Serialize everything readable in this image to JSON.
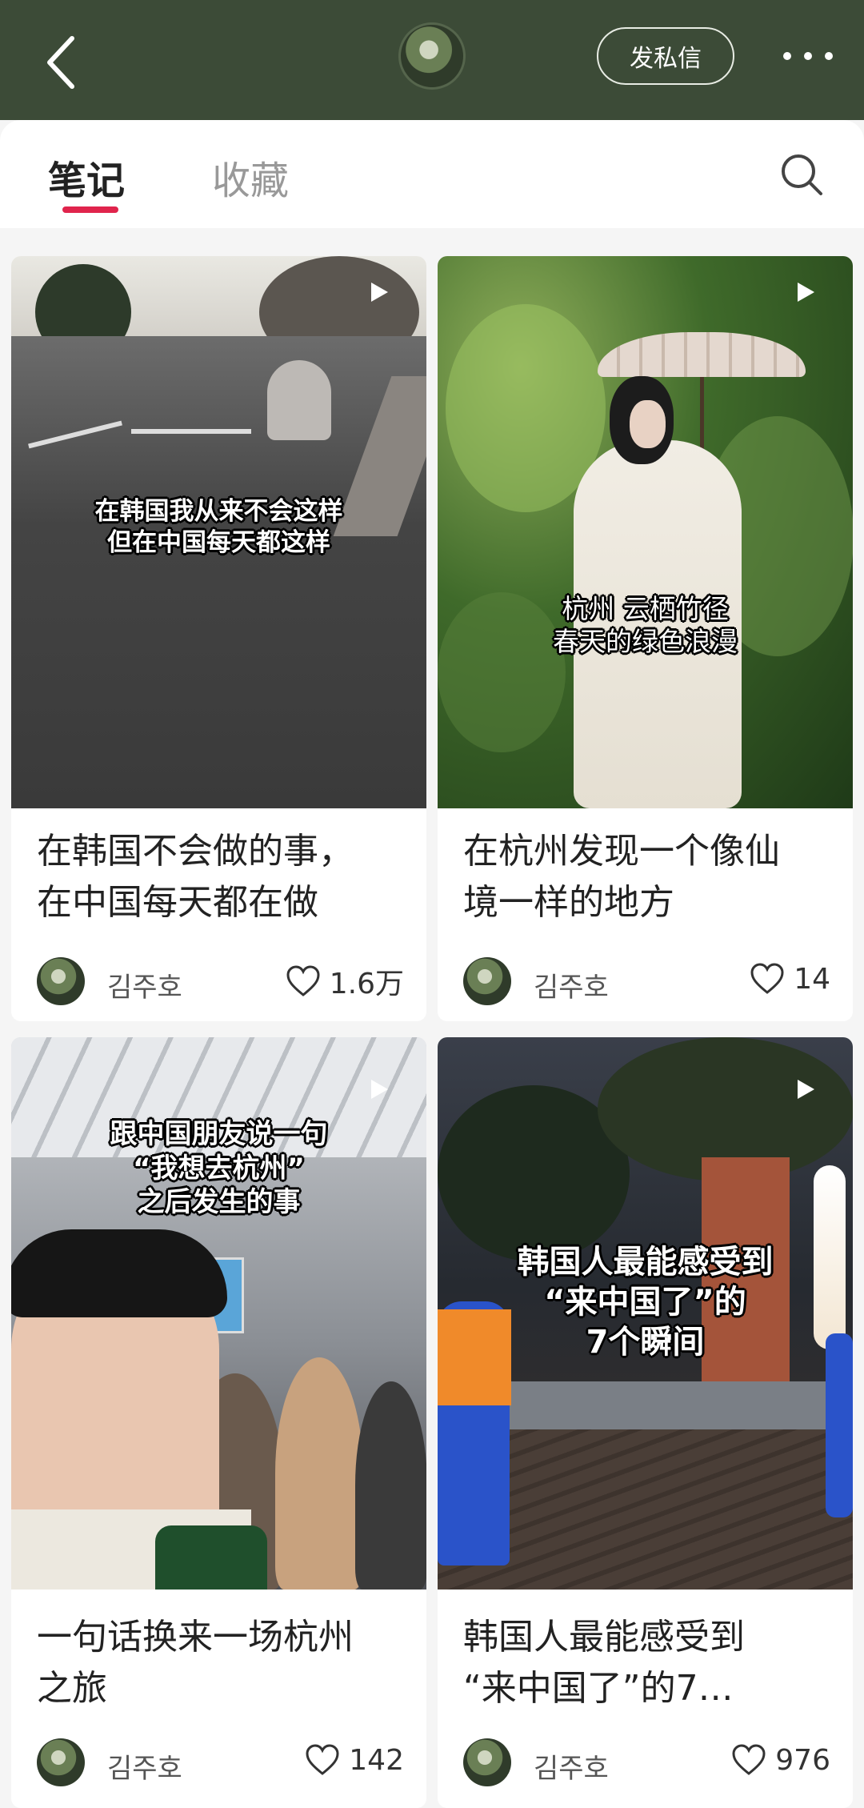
{
  "header": {
    "dm_label": "发私信"
  },
  "tabs": [
    {
      "label": "笔记",
      "active": true
    },
    {
      "label": "收藏",
      "active": false
    }
  ],
  "colors": {
    "header_bg": "#3c4b37",
    "accent": "#e0244c"
  },
  "cards": [
    {
      "overlay": [
        "在韩国我从来不会这样",
        "但在中国每天都这样"
      ],
      "title": [
        "在韩国不会做的事，",
        "在中国每天都在做"
      ],
      "author": "김주호",
      "likes": "1.6万"
    },
    {
      "overlay": [
        "杭州 云栖竹径",
        "春天的绿色浪漫"
      ],
      "title": [
        "在杭州发现一个像仙",
        "境一样的地方"
      ],
      "author": "김주호",
      "likes": "14"
    },
    {
      "overlay": [
        "跟中国朋友说一句",
        "“我想去杭州”",
        "之后发生的事"
      ],
      "title": [
        "一句话换来一场杭州",
        "之旅"
      ],
      "author": "김주호",
      "likes": "142"
    },
    {
      "overlay": [
        "韩国人最能感受到",
        "“来中国了”的",
        "7个瞬间"
      ],
      "title": [
        "韩国人最能感受到",
        "“来中国了”的7…"
      ],
      "author": "김주호",
      "likes": "976"
    }
  ]
}
